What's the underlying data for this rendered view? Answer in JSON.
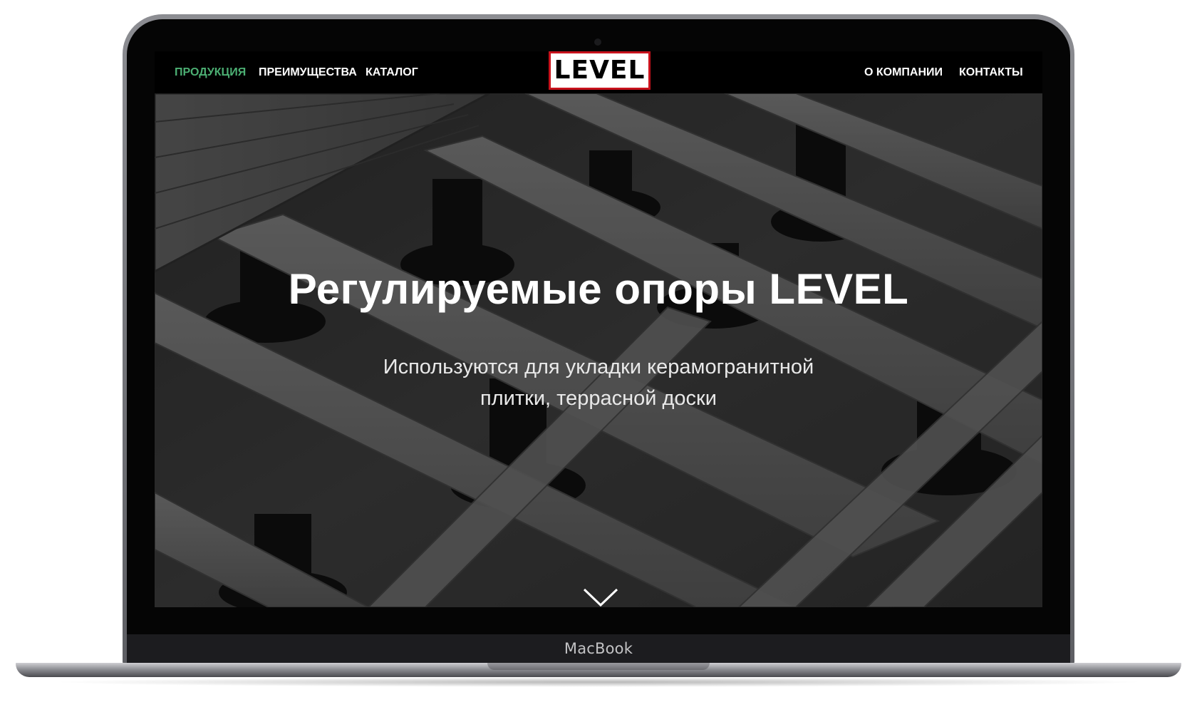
{
  "nav": {
    "left": [
      {
        "label": "ПРОДУКЦИЯ",
        "active": true
      },
      {
        "label": "ПРЕИМУЩЕСТВА",
        "active": false
      },
      {
        "label": "КАТАЛОГ",
        "active": false
      }
    ],
    "right": [
      {
        "label": "О КОМПАНИИ",
        "active": false
      },
      {
        "label": "КОНТАКТЫ",
        "active": false
      }
    ]
  },
  "logo": {
    "text": "LEVEL"
  },
  "hero": {
    "title": "Регулируемые опоры LEVEL",
    "subtitle": "Используются для укладки керамогранитной плитки, террасной доски",
    "scroll_icon": "chevron-down-icon"
  },
  "device": {
    "brand": "MacBook"
  },
  "colors": {
    "accent_green": "#4caf73",
    "logo_border": "#c8121c",
    "navbar_bg": "#000000"
  }
}
